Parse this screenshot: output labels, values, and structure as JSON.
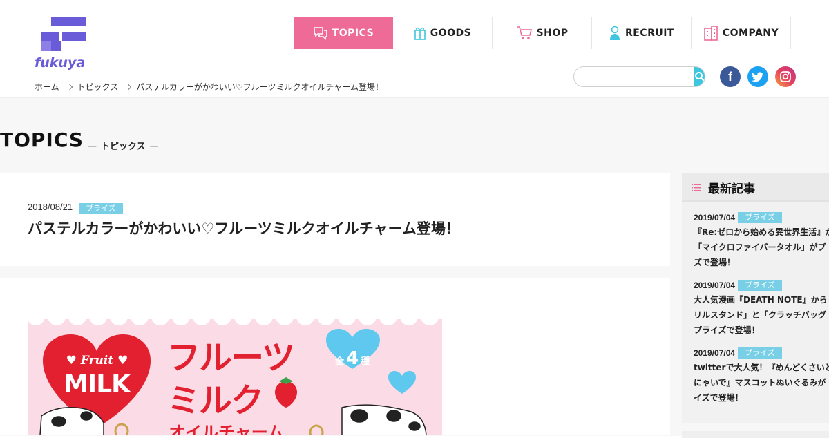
{
  "brand": {
    "name": "fukuya",
    "color": "#6a5bd8"
  },
  "nav": {
    "items": [
      {
        "label": "TOPICS",
        "icon": "chat-bubbles-icon",
        "active": true
      },
      {
        "label": "GOODS",
        "icon": "gift-box-icon"
      },
      {
        "label": "SHOP",
        "icon": "shopping-cart-icon"
      },
      {
        "label": "RECRUIT",
        "icon": "person-icon"
      },
      {
        "label": "COMPANY",
        "icon": "building-icon"
      }
    ],
    "active_color": "#ee6b97"
  },
  "search": {
    "placeholder": "",
    "icon": "search-icon"
  },
  "social": {
    "facebook": "f",
    "twitter": "twitter-icon",
    "instagram": "instagram-icon"
  },
  "breadcrumb": {
    "items": [
      "ホーム",
      "トピックス",
      "パステルカラーがかわいい♡フルーツミルクオイルチャーム登場！"
    ]
  },
  "section": {
    "title": "TOPICS",
    "subtitle": "トピックス",
    "dash": "—"
  },
  "article": {
    "date": "2018/08/21",
    "category": "プライズ",
    "title": "パステルカラーがかわいい♡フルーツミルクオイルチャーム登場！"
  },
  "banner": {
    "heart_top": "♥ Fruit ♥",
    "heart_main": "MILK",
    "line1": "フルーツ",
    "line2": "ミルク",
    "line3": "オイルチャーム",
    "count_prefix": "全",
    "count": "4",
    "count_suffix": "種"
  },
  "sidebar": {
    "title": "最新記事",
    "icon": "list-icon",
    "items": [
      {
        "date": "2019/07/04",
        "category": "プライズ",
        "lines": [
          "『Re:ゼロから始める異世界生活』か",
          "「マイクロファイバータオル」がプ",
          "ズで登場！"
        ]
      },
      {
        "date": "2019/07/04",
        "category": "プライズ",
        "lines": [
          "大人気漫画『DEATH NOTE』から「",
          "リルスタンド」と「クラッチバッグ",
          "プライズで登場！"
        ]
      },
      {
        "date": "2019/07/04",
        "category": "プライズ",
        "lines": [
          "twitterで大人気！『めんどくさいと言",
          "にゃいで』マスコットぬいぐるみが",
          "イズで登場！"
        ]
      }
    ]
  }
}
